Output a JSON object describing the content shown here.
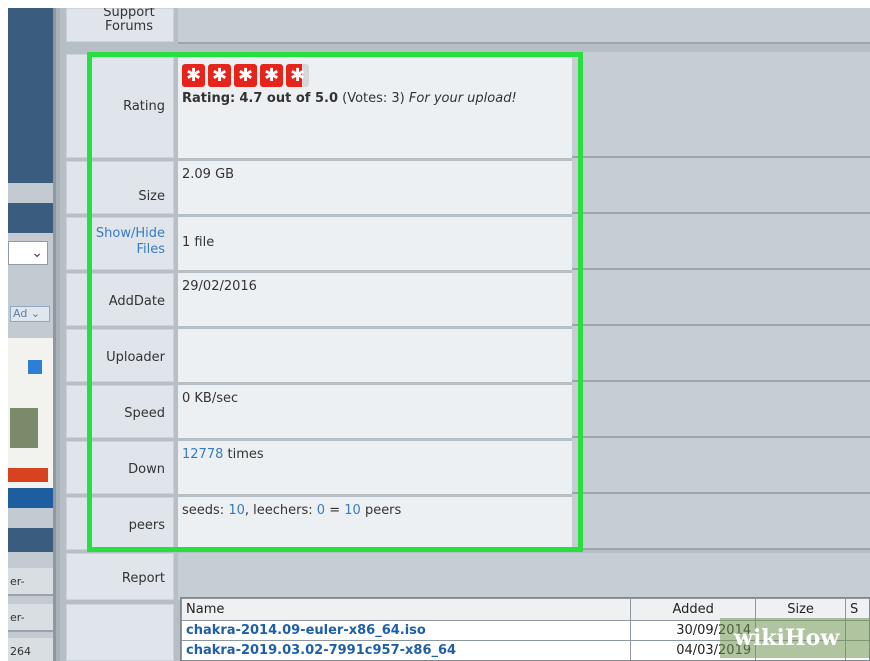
{
  "top_row": {
    "label": "Support Forums"
  },
  "details": {
    "rating": {
      "label": "Rating",
      "stars_value": 4.7,
      "stars_max": 5,
      "prefix": "Rating:",
      "score": "4.7 out of 5.0",
      "votes": "(Votes: 3)",
      "note": "For your upload!"
    },
    "size": {
      "label": "Size",
      "value": "2.09 GB"
    },
    "files": {
      "label": "Show/Hide Files",
      "value": "1 file"
    },
    "adddate": {
      "label": "AddDate",
      "value": "29/02/2016"
    },
    "uploader": {
      "label": "Uploader",
      "value": ""
    },
    "speed": {
      "label": "Speed",
      "value": "0 KB/sec"
    },
    "down": {
      "label": "Down",
      "count": "12778",
      "suffix": "times"
    },
    "peers": {
      "label": "peers",
      "seeds_label": "seeds:",
      "seeds": "10",
      "leechers_label": ", leechers:",
      "leechers": "0",
      "equals": "=",
      "total": "10",
      "suffix": "peers"
    },
    "report": {
      "label": "Report"
    }
  },
  "file_table": {
    "headers": [
      "Name",
      "Added",
      "Size",
      "S"
    ],
    "rows": [
      {
        "name": "chakra-2014.09-euler-x86_64.iso",
        "added": "30/09/2014",
        "size": "",
        "s": ""
      },
      {
        "name": "chakra-2019.03.02-7991c957-x86_64",
        "added": "04/03/2019",
        "size": "",
        "s": ""
      }
    ]
  },
  "sidebar": {
    "select_arrow": "⌄",
    "ad_label": "Ad",
    "rows": [
      "er-",
      "er-",
      "264"
    ]
  },
  "watermark": "wikiHow",
  "colors": {
    "highlight": "#27e040",
    "star": "#e5241b",
    "link": "#3a7bbf",
    "filename": "#1e5fa8"
  }
}
